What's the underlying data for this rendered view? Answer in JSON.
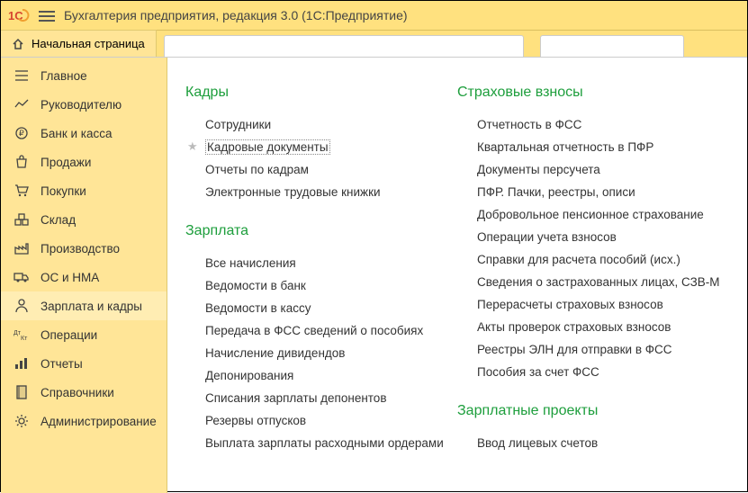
{
  "titlebar": {
    "app_title": "Бухгалтерия предприятия, редакция 3.0  (1С:Предприятие)"
  },
  "home_tab": "Начальная страница",
  "sidebar": {
    "items": [
      {
        "label": "Главное",
        "icon": "list"
      },
      {
        "label": "Руководителю",
        "icon": "chart"
      },
      {
        "label": "Банк и касса",
        "icon": "ruble"
      },
      {
        "label": "Продажи",
        "icon": "bag"
      },
      {
        "label": "Покупки",
        "icon": "cart"
      },
      {
        "label": "Склад",
        "icon": "boxes"
      },
      {
        "label": "Производство",
        "icon": "factory"
      },
      {
        "label": "ОС и НМА",
        "icon": "truck"
      },
      {
        "label": "Зарплата и кадры",
        "icon": "person",
        "active": true
      },
      {
        "label": "Операции",
        "icon": "dtkt"
      },
      {
        "label": "Отчеты",
        "icon": "bars"
      },
      {
        "label": "Справочники",
        "icon": "book"
      },
      {
        "label": "Администрирование",
        "icon": "gear"
      }
    ]
  },
  "content": {
    "col1": [
      {
        "header": "Кадры",
        "items": [
          {
            "label": "Сотрудники"
          },
          {
            "label": "Кадровые документы",
            "starred": true
          },
          {
            "label": "Отчеты по кадрам"
          },
          {
            "label": "Электронные трудовые книжки"
          }
        ]
      },
      {
        "header": "Зарплата",
        "items": [
          {
            "label": "Все начисления"
          },
          {
            "label": "Ведомости в банк"
          },
          {
            "label": "Ведомости в кассу"
          },
          {
            "label": "Передача в ФСС сведений о пособиях"
          },
          {
            "label": "Начисление дивидендов"
          },
          {
            "label": "Депонирования"
          },
          {
            "label": "Списания зарплаты депонентов"
          },
          {
            "label": "Резервы отпусков"
          },
          {
            "label": "Выплата зарплаты расходными ордерами"
          }
        ]
      }
    ],
    "col2": [
      {
        "header": "Страховые взносы",
        "items": [
          {
            "label": "Отчетность в ФСС"
          },
          {
            "label": "Квартальная отчетность в ПФР"
          },
          {
            "label": "Документы персучета"
          },
          {
            "label": "ПФР. Пачки, реестры, описи"
          },
          {
            "label": "Добровольное пенсионное страхование"
          },
          {
            "label": "Операции учета взносов"
          },
          {
            "label": "Справки для расчета пособий (исх.)"
          },
          {
            "label": "Сведения о застрахованных лицах, СЗВ-М"
          },
          {
            "label": "Перерасчеты страховых взносов"
          },
          {
            "label": "Акты проверок страховых взносов"
          },
          {
            "label": "Реестры ЭЛН для отправки в ФСС"
          },
          {
            "label": "Пособия за счет ФСС"
          }
        ]
      },
      {
        "header": "Зарплатные проекты",
        "items": [
          {
            "label": "Ввод лицевых счетов"
          }
        ]
      }
    ]
  }
}
